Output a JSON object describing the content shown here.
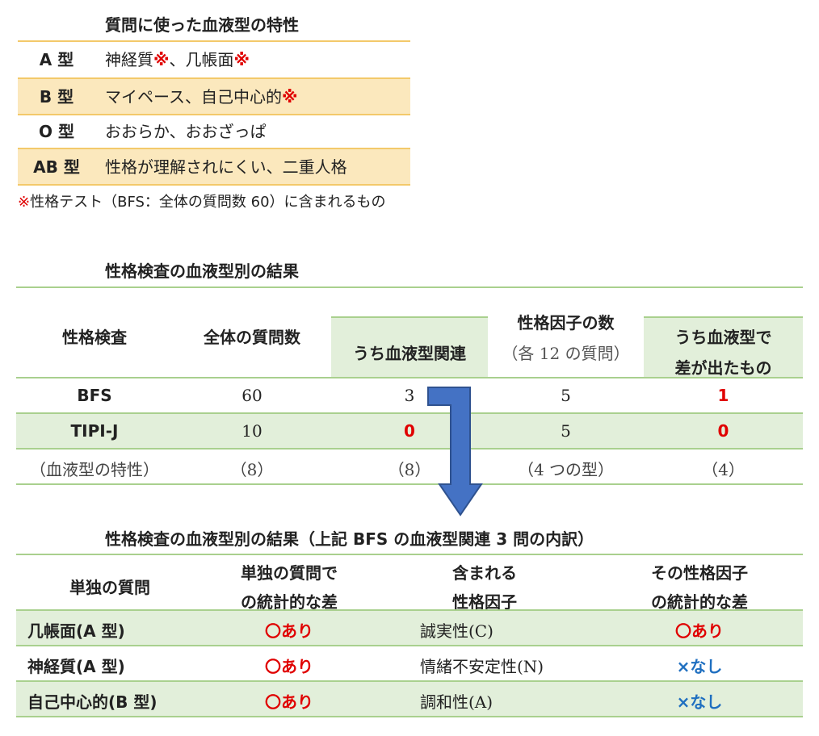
{
  "table1": {
    "title": "質問に使った血液型の特性",
    "rows": [
      {
        "type": "A 型",
        "text": "神経質",
        "mark1": "※",
        "sep": "、几帳面",
        "mark2": "※"
      },
      {
        "type": "B 型",
        "text": "マイペース、自己中心的",
        "mark1": "※",
        "sep": "",
        "mark2": ""
      },
      {
        "type": "O 型",
        "text": "おおらか、おおざっぱ",
        "mark1": "",
        "sep": "",
        "mark2": ""
      },
      {
        "type": "AB 型",
        "text": "性格が理解されにくい、二重人格",
        "mark1": "",
        "sep": "",
        "mark2": ""
      }
    ],
    "note_mark": "※",
    "note": "性格テスト（BFS：全体の質問数 60）に含まれるもの"
  },
  "table2": {
    "title": "性格検査の血液型別の結果",
    "headers": {
      "test": "性格検査",
      "total": "全体の質問数",
      "blood": "うち血液型関連",
      "factors": "性格因子の数",
      "factors_sub": "（各 12 の質問）",
      "diff_line1": "うち血液型で",
      "diff_line2": "差が出たもの"
    },
    "rows": [
      {
        "test": "BFS",
        "total": "60",
        "blood": "3",
        "factors": "5",
        "diff": "1"
      },
      {
        "test": "TIPI-J",
        "total": "10",
        "blood": "0",
        "factors": "5",
        "diff": "0"
      },
      {
        "test": "（血液型の特性）",
        "total": "（8）",
        "blood": "（8）",
        "factors": "（4 つの型）",
        "diff": "（4）"
      }
    ]
  },
  "table3": {
    "title": "性格検査の血液型別の結果（上記 BFS の血液型関連 3 問の内訳）",
    "headers": {
      "q": "単独の質問",
      "single_line1": "単独の質問で",
      "single_line2": "の統計的な差",
      "factor_line1": "含まれる",
      "factor_line2": "性格因子",
      "fdiff_line1": "その性格因子",
      "fdiff_line2": "の統計的な差"
    },
    "rows": [
      {
        "q": "几帳面(A 型)",
        "single": "〇あり",
        "factor": "誠実性(C)",
        "fdiff": "〇あり",
        "fdiff_color": "#e00000"
      },
      {
        "q": "神経質(A 型)",
        "single": "〇あり",
        "factor": "情緒不安定性(N)",
        "fdiff": "×なし",
        "fdiff_color": "#1f6fc0"
      },
      {
        "q": "自己中心的(B 型)",
        "single": "〇あり",
        "factor": "調和性(A)",
        "fdiff": "×なし",
        "fdiff_color": "#1f6fc0"
      }
    ]
  },
  "colors": {
    "yellow_shade": "#fbe8bd",
    "yellow_line": "#f3c96a",
    "green_shade": "#e2efda",
    "green_line": "#a9d08e",
    "arrow": "#4472c4",
    "red": "#e00000",
    "blue": "#1f6fc0"
  }
}
